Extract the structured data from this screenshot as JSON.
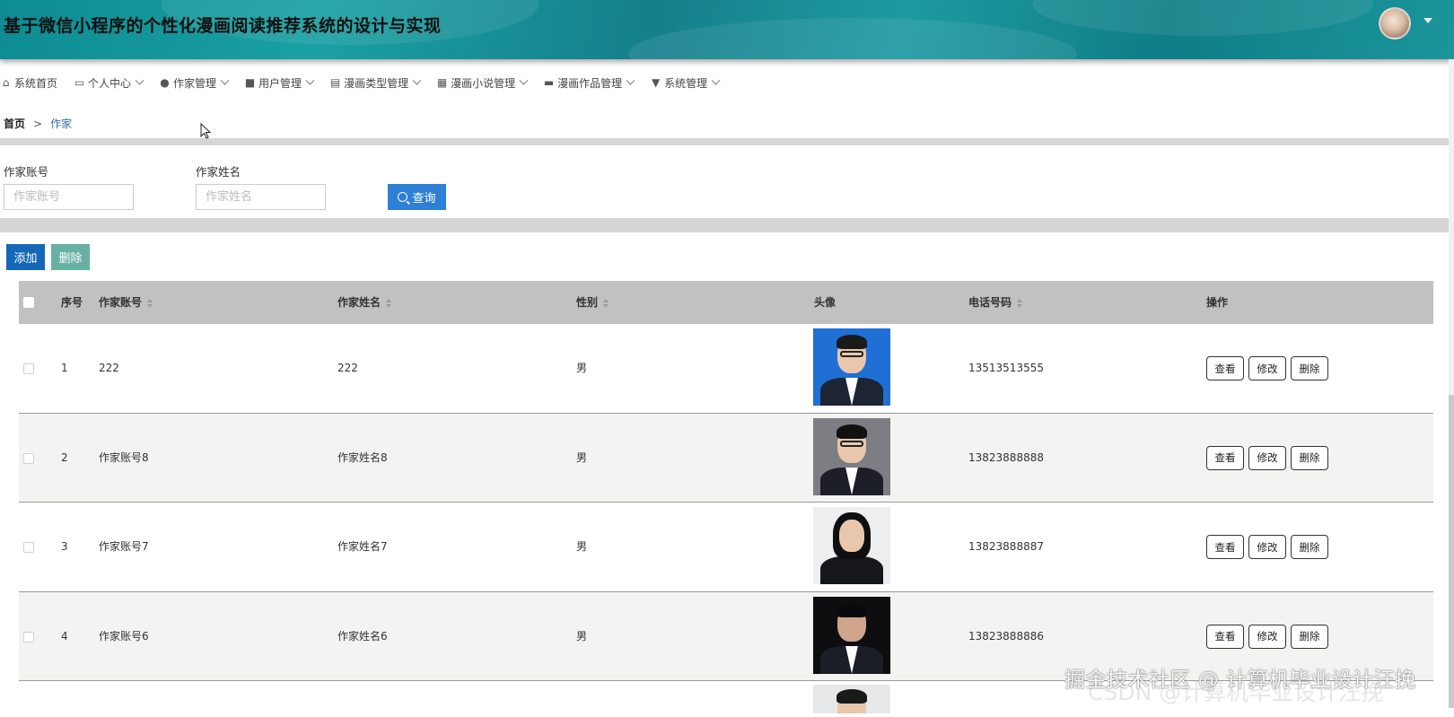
{
  "header": {
    "title": "基于微信小程序的个性化漫画阅读推荐系统的设计与实现"
  },
  "nav": {
    "items": [
      {
        "label": "系统首页",
        "icon": "home-icon",
        "dropdown": false
      },
      {
        "label": "个人中心",
        "icon": "card-icon",
        "dropdown": true
      },
      {
        "label": "作家管理",
        "icon": "user-icon",
        "dropdown": true
      },
      {
        "label": "用户管理",
        "icon": "briefcase-icon",
        "dropdown": true
      },
      {
        "label": "漫画类型管理",
        "icon": "clipboard-icon",
        "dropdown": true
      },
      {
        "label": "漫画小说管理",
        "icon": "grid-icon",
        "dropdown": true
      },
      {
        "label": "漫画作品管理",
        "icon": "comment-icon",
        "dropdown": true
      },
      {
        "label": "系统管理",
        "icon": "flag-icon",
        "dropdown": true
      }
    ]
  },
  "breadcrumb": {
    "home": "首页",
    "separator": ">",
    "current": "作家"
  },
  "search": {
    "account_label": "作家账号",
    "account_placeholder": "作家账号",
    "name_label": "作家姓名",
    "name_placeholder": "作家姓名",
    "query_button": "查询"
  },
  "actions": {
    "add": "添加",
    "delete": "删除"
  },
  "table": {
    "columns": [
      "序号",
      "作家账号",
      "作家姓名",
      "性别",
      "头像",
      "电话号码",
      "操作"
    ],
    "row_actions": [
      "查看",
      "修改",
      "删除"
    ],
    "rows": [
      {
        "index": "1",
        "account": "222",
        "name": "222",
        "gender": "男",
        "phone": "13513513555"
      },
      {
        "index": "2",
        "account": "作家账号8",
        "name": "作家姓名8",
        "gender": "男",
        "phone": "13823888888"
      },
      {
        "index": "3",
        "account": "作家账号7",
        "name": "作家姓名7",
        "gender": "男",
        "phone": "13823888887"
      },
      {
        "index": "4",
        "account": "作家账号6",
        "name": "作家姓名6",
        "gender": "男",
        "phone": "13823888886"
      }
    ]
  },
  "watermark": {
    "line1": "掘金技术社区 @ 计算机毕业设计汪挽",
    "line2": "CSDN @计算机毕业设计汪挽"
  },
  "colors": {
    "header_teal": "#1aa0a3",
    "query_button": "#2e7fd6",
    "add_button": "#1567b8",
    "delete_button": "#68b0a4",
    "table_header": "#c1c1c1"
  }
}
